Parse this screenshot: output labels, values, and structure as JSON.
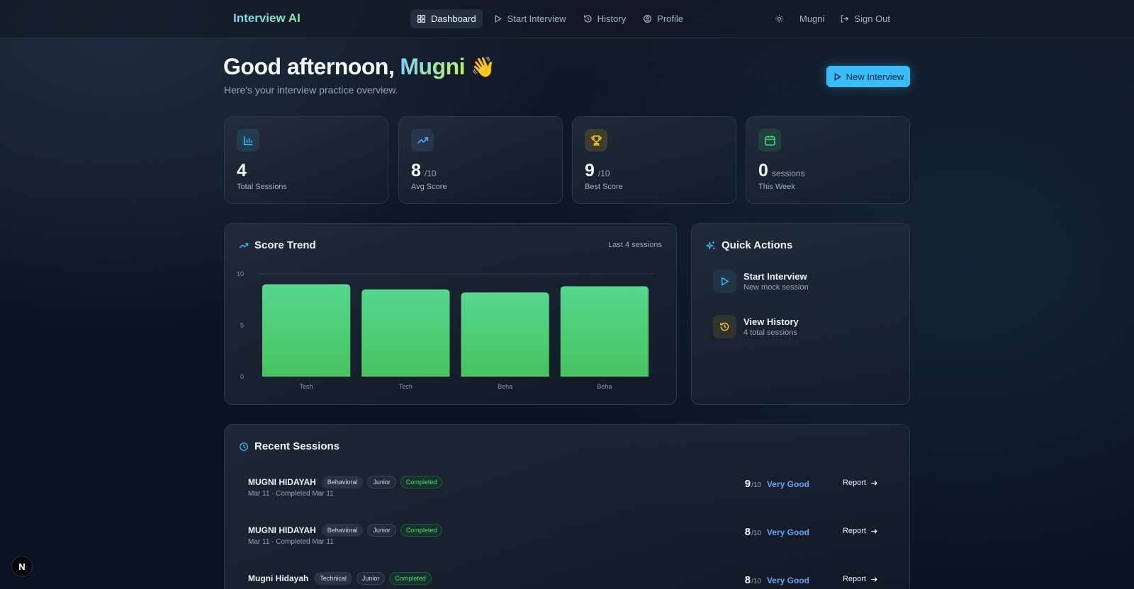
{
  "nav": {
    "brand": "Interview AI",
    "links": [
      {
        "label": "Dashboard"
      },
      {
        "label": "Start Interview"
      },
      {
        "label": "History"
      },
      {
        "label": "Profile"
      }
    ],
    "user": "Mugni",
    "sign_out": "Sign Out"
  },
  "header": {
    "greeting": "Good afternoon,",
    "name": "Mugni",
    "emoji": "👋",
    "subtitle": "Here's your interview practice overview.",
    "new_button": "New Interview"
  },
  "stats": [
    {
      "value": "4",
      "unit": "",
      "label": "Total Sessions",
      "icon": "bar-chart-icon",
      "color": "#38bdf8"
    },
    {
      "value": "8",
      "unit": "/10",
      "label": "Avg Score",
      "icon": "trending-up-icon",
      "color": "#60a5fa"
    },
    {
      "value": "9",
      "unit": "/10",
      "label": "Best Score",
      "icon": "trophy-icon",
      "color": "#facc15"
    },
    {
      "value": "0",
      "unit": "sessions",
      "label": "This Week",
      "icon": "calendar-icon",
      "color": "#4ade80"
    }
  ],
  "score_trend": {
    "title": "Score Trend",
    "subtitle": "Last 4 sessions"
  },
  "chart_data": {
    "type": "bar",
    "categories": [
      "Tech",
      "Tech",
      "Beha",
      "Beha"
    ],
    "values": [
      9,
      8.5,
      8.2,
      8.8
    ],
    "title": "",
    "xlabel": "",
    "ylabel": "",
    "ylim": [
      0,
      10
    ],
    "yticks": [
      "0",
      "5",
      "10"
    ],
    "grid": true,
    "color": "#4ade80"
  },
  "quick_actions": {
    "title": "Quick Actions",
    "items": [
      {
        "title": "Start Interview",
        "subtitle": "New mock session"
      },
      {
        "title": "View History",
        "subtitle": "4 total sessions"
      }
    ]
  },
  "recent": {
    "title": "Recent Sessions",
    "rows": [
      {
        "name": "MUGNI HIDAYAH",
        "type": "Behavioral",
        "level": "Junior",
        "status": "Completed",
        "meta": "Mar 11 · Completed Mar 11",
        "score": "9",
        "denom": "/10",
        "rating": "Very Good",
        "action": "Report"
      },
      {
        "name": "MUGNI HIDAYAH",
        "type": "Behavioral",
        "level": "Junior",
        "status": "Completed",
        "meta": "Mar 11 · Completed Mar 11",
        "score": "8",
        "denom": "/10",
        "rating": "Very Good",
        "action": "Report"
      },
      {
        "name": "Mugni Hidayah",
        "type": "Technical",
        "level": "Junior",
        "status": "Completed",
        "meta": "",
        "score": "8",
        "denom": "/10",
        "rating": "Very Good",
        "action": "Report"
      }
    ]
  },
  "dev_badge": "N"
}
